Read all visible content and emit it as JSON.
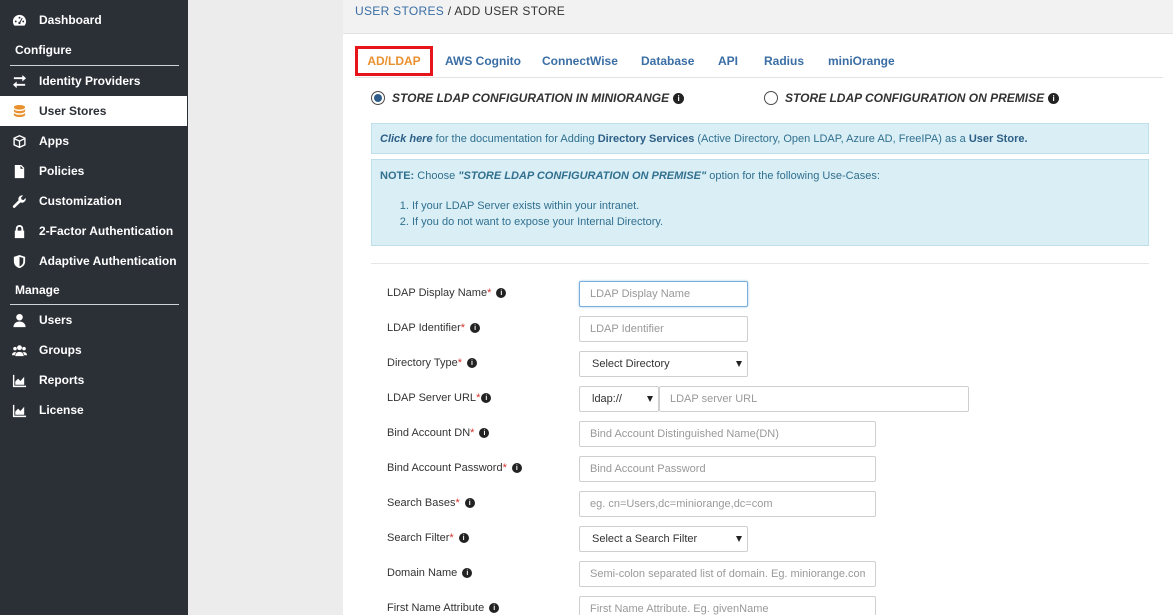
{
  "sidebar": {
    "dashboard": "Dashboard",
    "section_configure": "Configure",
    "identity_providers": "Identity Providers",
    "user_stores": "User Stores",
    "apps": "Apps",
    "policies": "Policies",
    "customization": "Customization",
    "two_factor": "2-Factor Authentication",
    "adaptive": "Adaptive Authentication",
    "section_manage": "Manage",
    "users": "Users",
    "groups": "Groups",
    "reports": "Reports",
    "license": "License"
  },
  "breadcrumb": {
    "parent": "USER STORES",
    "separator": " / ",
    "current": "ADD USER STORE"
  },
  "tabs": [
    "AD/LDAP",
    "AWS Cognito",
    "ConnectWise",
    "Database",
    "API",
    "Radius",
    "miniOrange"
  ],
  "radio": {
    "miniorange": "STORE LDAP CONFIGURATION IN MINIORANGE",
    "premise": "STORE LDAP CONFIGURATION ON PREMISE",
    "selected": "miniorange"
  },
  "info_glyph": "i",
  "alert_doc": {
    "link": "Click here",
    "text1": " for the documentation for Adding ",
    "strong1": "Directory Services",
    "text2": " (Active Directory, Open LDAP, Azure AD, FreeIPA) as a ",
    "strong2": "User Store."
  },
  "alert_note": {
    "label": "NOTE:",
    "pre": "  Choose ",
    "quote": "\"STORE LDAP CONFIGURATION ON PREMISE\"",
    "post": " option for the following Use-Cases:",
    "items": [
      "If your LDAP Server exists within your intranet.",
      "If you do not want to expose your Internal Directory."
    ]
  },
  "form": {
    "required_mark": "*",
    "display_name": {
      "label": "LDAP Display Name",
      "placeholder": "LDAP Display Name"
    },
    "identifier": {
      "label": "LDAP Identifier",
      "placeholder": "LDAP Identifier"
    },
    "directory_type": {
      "label": "Directory Type",
      "value": "Select Directory"
    },
    "server_url": {
      "label": "LDAP Server URL",
      "protocol": "ldap://",
      "placeholder": "LDAP server URL"
    },
    "bind_dn": {
      "label": "Bind Account DN",
      "placeholder": "Bind Account Distinguished Name(DN)"
    },
    "bind_password": {
      "label": "Bind Account Password",
      "placeholder": "Bind Account Password"
    },
    "search_bases": {
      "label": "Search Bases",
      "placeholder": "eg. cn=Users,dc=miniorange,dc=com"
    },
    "search_filter": {
      "label": "Search Filter",
      "value": "Select a Search Filter"
    },
    "domain_name": {
      "label": "Domain Name",
      "placeholder": "Semi-colon separated list of domain. Eg. miniorange.com"
    },
    "first_name_attr": {
      "label": "First Name Attribute",
      "placeholder": "First Name Attribute. Eg. givenName"
    }
  },
  "colors": {
    "sidebar_bg": "#2b2f36",
    "accent_orange": "#e8912d",
    "link_blue": "#3a6ea5",
    "active_tab_border": "#e8141c",
    "alert_bg": "#d9eef5"
  }
}
